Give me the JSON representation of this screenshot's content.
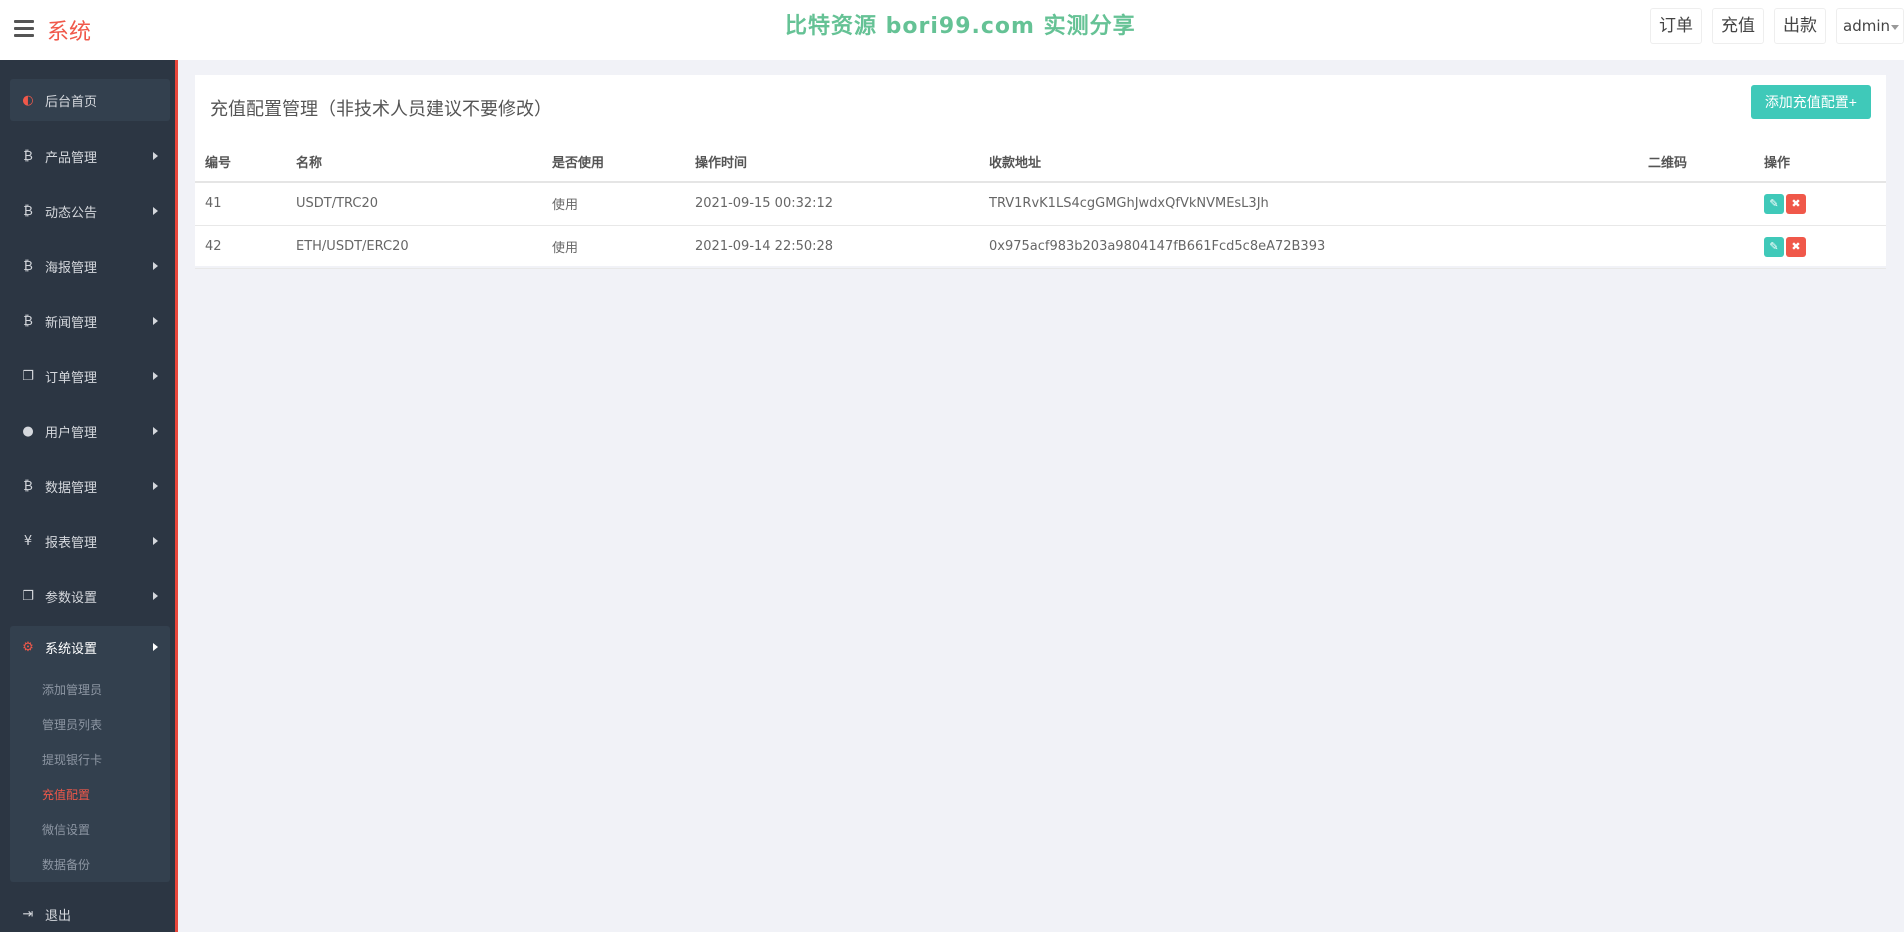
{
  "header": {
    "brand": "系统",
    "watermark": "比特资源 bori99.com 实测分享",
    "buttons": [
      "订单",
      "充值",
      "出款"
    ],
    "user": "admin"
  },
  "sidebar": {
    "items": [
      {
        "label": "后台首页",
        "icon": "dashboard-icon"
      },
      {
        "label": "产品管理",
        "icon": "bitcoin-icon"
      },
      {
        "label": "动态公告",
        "icon": "bitcoin-icon"
      },
      {
        "label": "海报管理",
        "icon": "bitcoin-icon"
      },
      {
        "label": "新闻管理",
        "icon": "bitcoin-icon"
      },
      {
        "label": "订单管理",
        "icon": "copy-icon"
      },
      {
        "label": "用户管理",
        "icon": "user-icon"
      },
      {
        "label": "数据管理",
        "icon": "bitcoin-icon"
      },
      {
        "label": "报表管理",
        "icon": "yen-icon"
      },
      {
        "label": "参数设置",
        "icon": "copy-icon"
      },
      {
        "label": "系统设置",
        "icon": "cogs-icon"
      }
    ],
    "sub_items": [
      "添加管理员",
      "管理员列表",
      "提现银行卡",
      "充值配置",
      "微信设置",
      "数据备份"
    ],
    "current_sub": "充值配置",
    "logout": "退出"
  },
  "panel": {
    "title": "充值配置管理（非技术人员建议不要修改）",
    "add_button": "添加充值配置+",
    "columns": [
      "编号",
      "名称",
      "是否使用",
      "操作时间",
      "收款地址",
      "二维码",
      "操作"
    ],
    "rows": [
      {
        "id": "41",
        "name": "USDT/TRC20",
        "status": "使用",
        "time": "2021-09-15 00:32:12",
        "address": "TRV1RvK1LS4cgGMGhJwdxQfVkNVMEsL3Jh",
        "qr": ""
      },
      {
        "id": "42",
        "name": "ETH/USDT/ERC20",
        "status": "使用",
        "time": "2021-09-14 22:50:28",
        "address": "0x975acf983b203a9804147fB661Fcd5c8eA72B393",
        "qr": ""
      }
    ]
  }
}
